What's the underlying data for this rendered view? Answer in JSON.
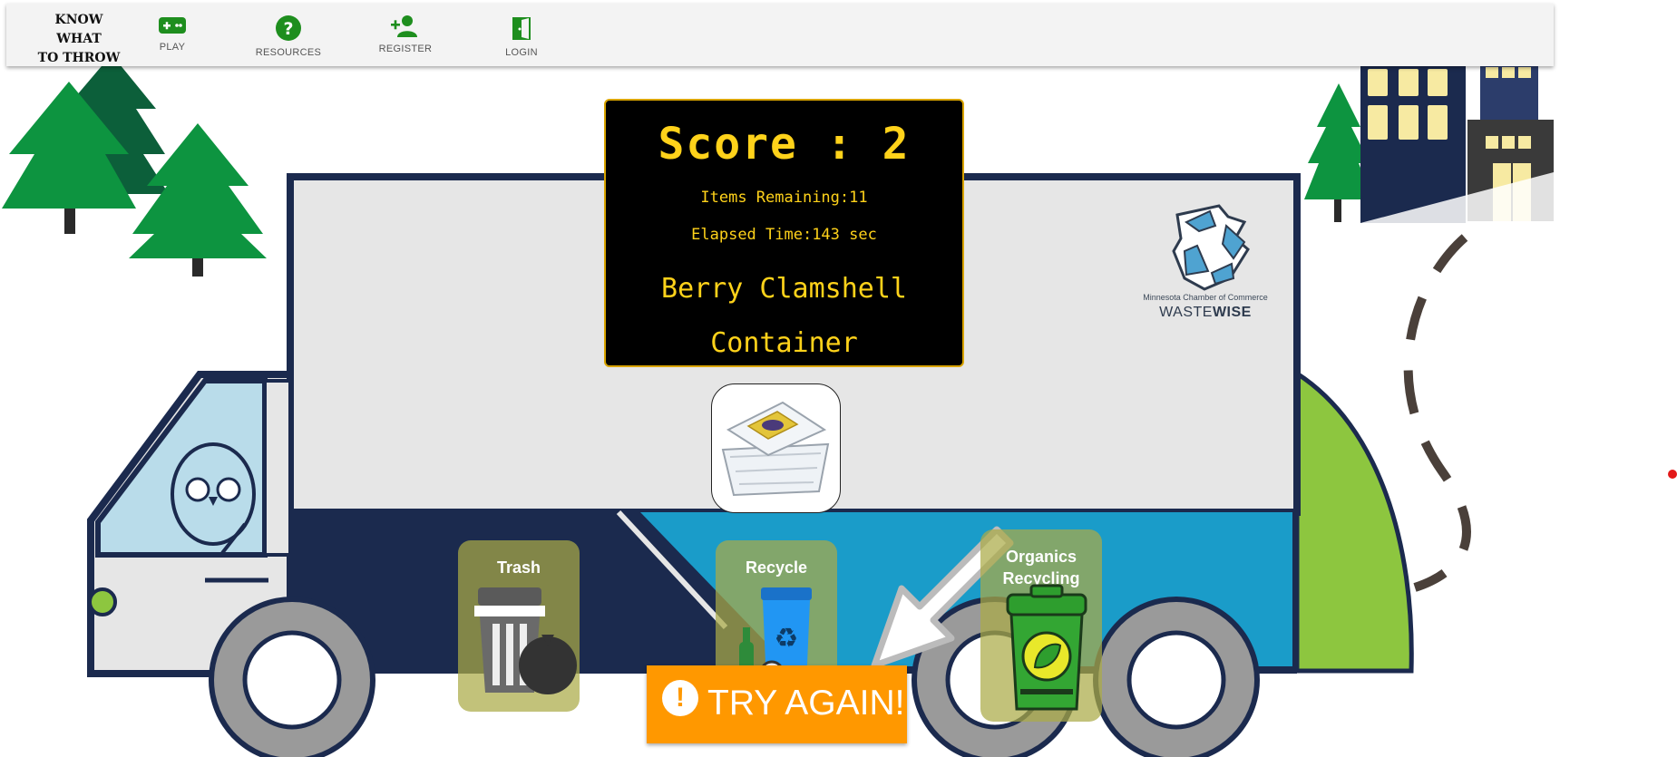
{
  "nav": {
    "brand": [
      "KNOW",
      "WHAT",
      "TO THROW"
    ],
    "items": [
      {
        "label": "PLAY",
        "icon": "gamepad-icon"
      },
      {
        "label": "RESOURCES",
        "icon": "help-circle-icon"
      },
      {
        "label": "REGISTER",
        "icon": "add-user-icon"
      },
      {
        "label": "LOGIN",
        "icon": "door-icon"
      }
    ],
    "icon_color": "#1e8e1e"
  },
  "scoreboard": {
    "score_text": "Score : 2",
    "items_remaining": "Items Remaining:11",
    "elapsed_time": "Elapsed Time:143 sec",
    "current_item": "Berry Clamshell Container",
    "text_color": "#ffd21a"
  },
  "bins": [
    {
      "label": "Trash",
      "icon": "trash-can-icon"
    },
    {
      "label": "Recycle",
      "icon": "recycle-bin-icon"
    },
    {
      "label": "Organics Recycling",
      "icon": "organics-bin-icon"
    }
  ],
  "feedback": {
    "button_label": "TRY AGAIN!",
    "icon": "alert-icon",
    "color": "#ff9800"
  },
  "logo": {
    "small_text": "Minnesota Chamber of Commerce",
    "brand_light": "WASTE",
    "brand_bold": "WISE"
  },
  "colors": {
    "truck_navy": "#1b2a4e",
    "truck_body": "#e6e6e6",
    "truck_blue": "#1a9cc9",
    "tree_green": "#0d9440",
    "cab_window": "#b9dcea",
    "organics_green": "#8dc63f"
  }
}
